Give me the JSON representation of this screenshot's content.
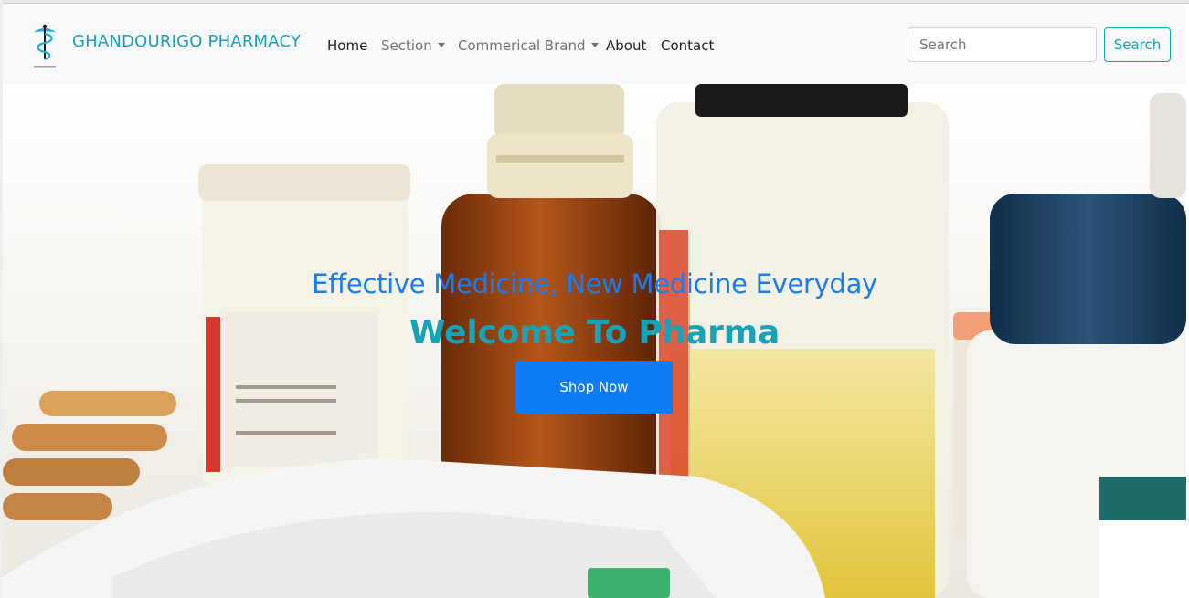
{
  "navbar": {
    "brand": "GHANDOURIGO PHARMACY",
    "logo_icon": "caduceus-icon",
    "items": [
      {
        "label": "Home",
        "dropdown": false
      },
      {
        "label": "Section",
        "dropdown": true
      },
      {
        "label": "Commerical Brand",
        "dropdown": true
      },
      {
        "label": "About",
        "dropdown": false
      },
      {
        "label": "Contact",
        "dropdown": false
      }
    ],
    "search": {
      "placeholder": "Search",
      "button_label": "Search"
    }
  },
  "hero": {
    "subtitle": "Effective Medicine, New Medicine Everyday",
    "title": "Welcome To Pharma",
    "cta_label": "Shop Now"
  },
  "colors": {
    "brand": "#17a2b8",
    "subtitle": "#1a7cf0",
    "primary_button": "#0d7cf5",
    "navbar_bg": "#f8f9fa"
  }
}
